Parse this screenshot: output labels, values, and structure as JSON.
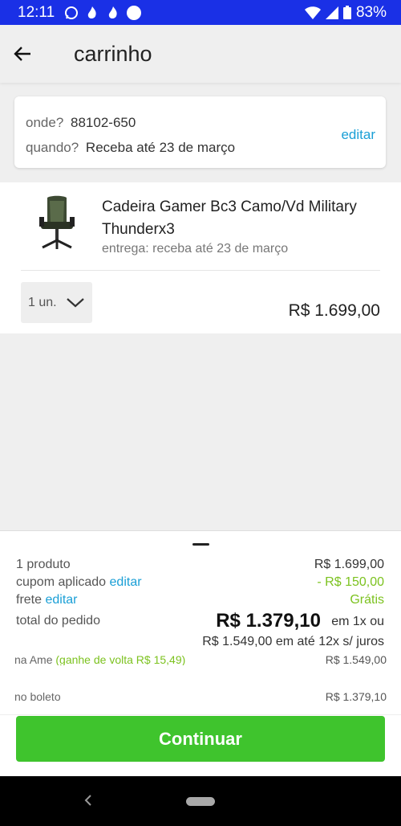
{
  "status_bar": {
    "time": "12:11",
    "battery": "83%"
  },
  "header": {
    "title": "carrinho"
  },
  "delivery": {
    "where_label": "onde?",
    "where_value": "88102-650",
    "when_label": "quando?",
    "when_value": "Receba até 23 de março",
    "edit_label": "editar"
  },
  "product": {
    "name": "Cadeira Gamer Bc3 Camo/Vd Military Thunderx3",
    "delivery": "entrega: receba até 23 de março",
    "quantity": "1 un.",
    "price": "R$ 1.699,00"
  },
  "summary": {
    "products_label": "1 produto",
    "products_value": "R$ 1.699,00",
    "coupon_label": "cupom aplicado",
    "coupon_edit": "editar",
    "coupon_value": "- R$ 150,00",
    "shipping_label": "frete",
    "shipping_edit": "editar",
    "shipping_value": "Grátis",
    "total_label": "total do pedido",
    "total_value": "R$ 1.379,10",
    "total_installments": "em 1x ou",
    "total_line2": "R$ 1.549,00 em até 12x s/ juros",
    "ame_label": "na Ame",
    "ame_cashback": "(ganhe de volta R$ 15,49)",
    "ame_value": "R$ 1.549,00",
    "boleto_label": "no boleto",
    "boleto_value": "R$ 1.379,10"
  },
  "actions": {
    "continue_label": "Continuar"
  },
  "colors": {
    "status_bar": "#1a30e6",
    "link": "#1a9fd6",
    "discount": "#7cc21f",
    "continue_button": "#3fc42d"
  }
}
